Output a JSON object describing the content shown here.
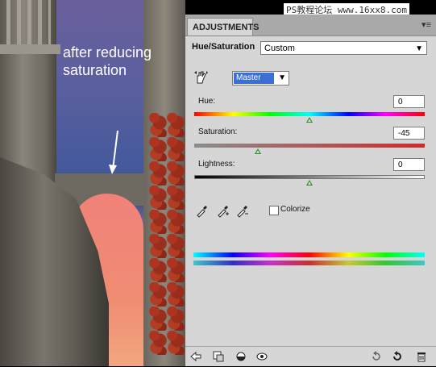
{
  "photo": {
    "caption_line1": "after reducing",
    "caption_line2": "saturation"
  },
  "watermark": "PS教程论坛 www.16xx8.com",
  "panel": {
    "tab_label": "ADJUSTMENTS",
    "menu_glyph": "▾≡",
    "title": "Hue/Saturation",
    "preset_value": "Custom",
    "channel_value": "Master",
    "hue": {
      "label": "Hue:",
      "value": "0",
      "thumb_fraction": 0.5
    },
    "saturation": {
      "label": "Saturation:",
      "value": "-45",
      "thumb_fraction": 0.275
    },
    "lightness": {
      "label": "Lightness:",
      "value": "0",
      "thumb_fraction": 0.5
    },
    "colorize": {
      "label": "Colorize",
      "checked": false
    }
  },
  "colors": {
    "panel_bg": "#d6d6d6",
    "selection_blue": "#3b6fd4",
    "thumb_green": "#2f8a2f"
  },
  "icons": [
    "hand-adjust-icon",
    "eyedropper-icon",
    "eyedropper-plus-icon",
    "eyedropper-minus-icon",
    "back-arrow-icon",
    "clip-layer-icon",
    "visibility-circle-icon",
    "eye-icon",
    "reset-icon",
    "refresh-icon",
    "trash-icon"
  ]
}
